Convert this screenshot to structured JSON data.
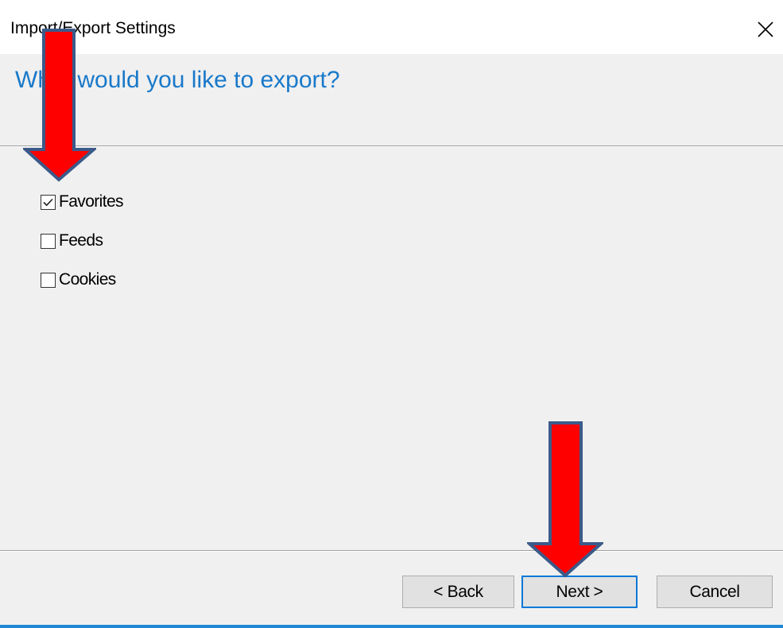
{
  "window": {
    "title": "Import/Export Settings"
  },
  "main": {
    "heading": "What would you like to export?",
    "options": [
      {
        "label": "Favorites",
        "checked": true
      },
      {
        "label": "Feeds",
        "checked": false
      },
      {
        "label": "Cookies",
        "checked": false
      }
    ]
  },
  "footer": {
    "back_label": "< Back",
    "next_label": "Next >",
    "cancel_label": "Cancel"
  },
  "annotations": {
    "arrow_color": "#ff0000",
    "arrow_outline_color": "#3b5a8a"
  },
  "colors": {
    "heading": "#1979ca",
    "focus_border": "#0078d7",
    "accent_bar": "#1e88d4"
  },
  "icons": {
    "close": "close-icon",
    "check": "checkmark-icon",
    "arrow": "down-arrow-annotation"
  }
}
